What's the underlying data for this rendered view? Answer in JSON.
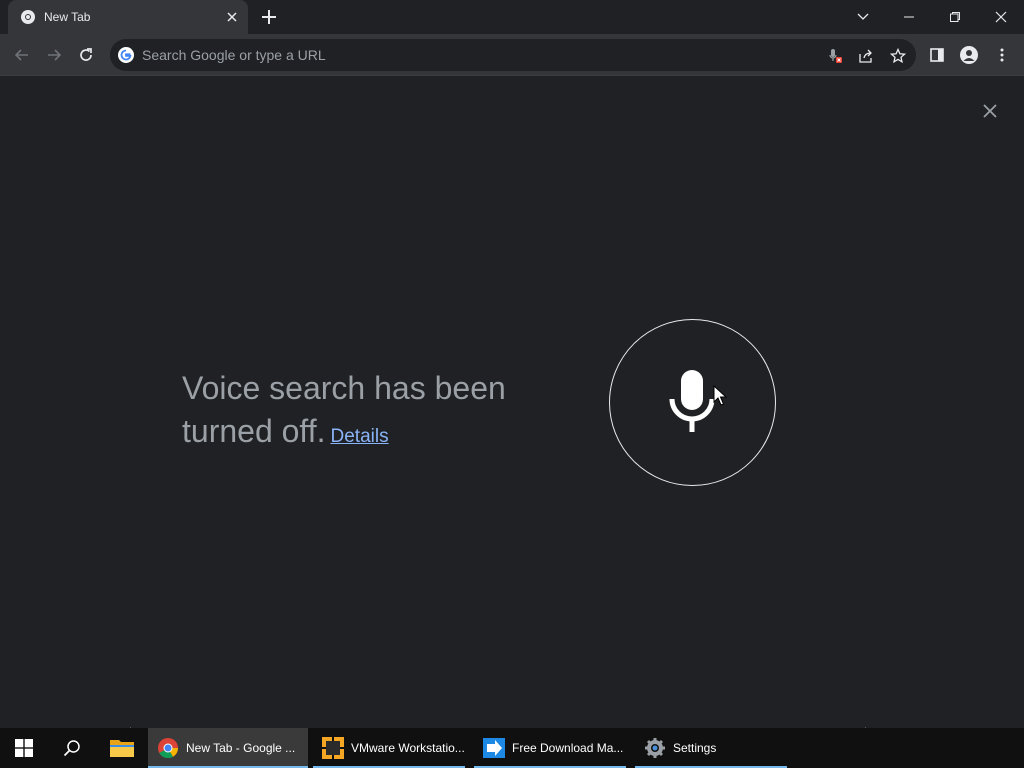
{
  "tab": {
    "title": "New Tab",
    "favicon": "chrome-icon"
  },
  "window_controls": [
    "tab-search-icon",
    "minimize-icon",
    "restore-icon",
    "close-icon"
  ],
  "omnibox": {
    "placeholder": "Search Google or type a URL",
    "value": ""
  },
  "toolbar_icons": [
    "back-icon",
    "forward-icon",
    "reload-icon",
    "mic-blocked-icon",
    "share-icon",
    "star-icon",
    "side-panel-icon",
    "profile-icon",
    "menu-icon"
  ],
  "voice": {
    "message": "Voice search has been turned off.",
    "details_link": "Details"
  },
  "taskbar": {
    "apps": [
      {
        "label": "New Tab - Google ...",
        "icon": "chrome-icon",
        "active": true
      },
      {
        "label": "VMware Workstatio...",
        "icon": "vmware-icon",
        "active": false
      },
      {
        "label": "Free Download Ma...",
        "icon": "fdm-icon",
        "active": false
      },
      {
        "label": "Settings",
        "icon": "gear-icon",
        "active": false
      }
    ]
  },
  "colors": {
    "background": "#202124",
    "toolbar": "#35363a",
    "link": "#8ab4f8",
    "message": "#9aa0a6",
    "taskbar": "#101010",
    "taskbar_accent": "#76b9ed"
  }
}
